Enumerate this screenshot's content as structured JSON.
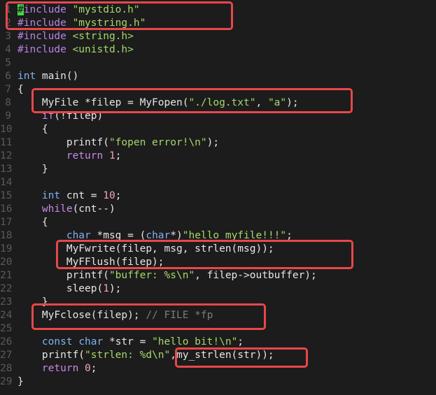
{
  "editor": {
    "lines": [
      {
        "n": "1",
        "tokens": [
          {
            "t": "#",
            "c": "cursor"
          },
          {
            "t": "include ",
            "c": "pp"
          },
          {
            "t": "\"mystdio.h\"",
            "c": "str"
          }
        ]
      },
      {
        "n": "2",
        "tokens": [
          {
            "t": "#include ",
            "c": "pp"
          },
          {
            "t": "\"mystring.h\"",
            "c": "str"
          }
        ]
      },
      {
        "n": "3",
        "tokens": [
          {
            "t": "#include ",
            "c": "pp"
          },
          {
            "t": "<string.h>",
            "c": "str"
          }
        ]
      },
      {
        "n": "4",
        "tokens": [
          {
            "t": "#include ",
            "c": "pp"
          },
          {
            "t": "<unistd.h>",
            "c": "str"
          }
        ]
      },
      {
        "n": "5",
        "tokens": []
      },
      {
        "n": "6",
        "tokens": [
          {
            "t": "int",
            "c": "type"
          },
          {
            "t": " main()",
            "c": ""
          }
        ]
      },
      {
        "n": "7",
        "tokens": [
          {
            "t": "{",
            "c": ""
          }
        ]
      },
      {
        "n": "8",
        "tokens": [
          {
            "t": "    MyFile *filep = MyFopen(",
            "c": ""
          },
          {
            "t": "\"./log.txt\"",
            "c": "str"
          },
          {
            "t": ", ",
            "c": ""
          },
          {
            "t": "\"a\"",
            "c": "str"
          },
          {
            "t": ");",
            "c": ""
          }
        ]
      },
      {
        "n": "9",
        "tokens": [
          {
            "t": "    ",
            "c": ""
          },
          {
            "t": "if",
            "c": "kw"
          },
          {
            "t": "(!filep)",
            "c": ""
          }
        ]
      },
      {
        "n": "10",
        "tokens": [
          {
            "t": "    {",
            "c": ""
          }
        ]
      },
      {
        "n": "11",
        "tokens": [
          {
            "t": "        printf(",
            "c": ""
          },
          {
            "t": "\"fopen error!\\n\"",
            "c": "str"
          },
          {
            "t": ");",
            "c": ""
          }
        ]
      },
      {
        "n": "12",
        "tokens": [
          {
            "t": "        ",
            "c": ""
          },
          {
            "t": "return",
            "c": "kw"
          },
          {
            "t": " ",
            "c": ""
          },
          {
            "t": "1",
            "c": "num"
          },
          {
            "t": ";",
            "c": ""
          }
        ]
      },
      {
        "n": "13",
        "tokens": [
          {
            "t": "    }",
            "c": ""
          }
        ]
      },
      {
        "n": "14",
        "tokens": []
      },
      {
        "n": "15",
        "tokens": [
          {
            "t": "    ",
            "c": ""
          },
          {
            "t": "int",
            "c": "type"
          },
          {
            "t": " cnt = ",
            "c": ""
          },
          {
            "t": "10",
            "c": "num"
          },
          {
            "t": ";",
            "c": ""
          }
        ]
      },
      {
        "n": "16",
        "tokens": [
          {
            "t": "    ",
            "c": ""
          },
          {
            "t": "while",
            "c": "kw"
          },
          {
            "t": "(cnt--)",
            "c": ""
          }
        ]
      },
      {
        "n": "17",
        "tokens": [
          {
            "t": "    {",
            "c": ""
          }
        ]
      },
      {
        "n": "18",
        "tokens": [
          {
            "t": "        ",
            "c": ""
          },
          {
            "t": "char",
            "c": "type"
          },
          {
            "t": " *msg = (",
            "c": ""
          },
          {
            "t": "char",
            "c": "type"
          },
          {
            "t": "*)",
            "c": ""
          },
          {
            "t": "\"hello myfile!!!\"",
            "c": "str"
          },
          {
            "t": ";",
            "c": ""
          }
        ]
      },
      {
        "n": "19",
        "tokens": [
          {
            "t": "        MyFwrite(filep, msg, strlen(msg));",
            "c": ""
          }
        ]
      },
      {
        "n": "20",
        "tokens": [
          {
            "t": "        MyFFlush(filep);",
            "c": ""
          }
        ]
      },
      {
        "n": "21",
        "tokens": [
          {
            "t": "        printf(",
            "c": ""
          },
          {
            "t": "\"buffer: %s\\n\"",
            "c": "str"
          },
          {
            "t": ", filep->outbuffer);",
            "c": ""
          }
        ]
      },
      {
        "n": "22",
        "tokens": [
          {
            "t": "        sleep(",
            "c": ""
          },
          {
            "t": "1",
            "c": "num"
          },
          {
            "t": ");",
            "c": ""
          }
        ]
      },
      {
        "n": "23",
        "tokens": [
          {
            "t": "    }",
            "c": ""
          }
        ]
      },
      {
        "n": "24",
        "tokens": [
          {
            "t": "    MyFclose(filep); ",
            "c": ""
          },
          {
            "t": "// FILE *fp",
            "c": "cmt"
          }
        ]
      },
      {
        "n": "25",
        "tokens": []
      },
      {
        "n": "26",
        "tokens": [
          {
            "t": "    ",
            "c": ""
          },
          {
            "t": "const",
            "c": "type"
          },
          {
            "t": " ",
            "c": ""
          },
          {
            "t": "char",
            "c": "type"
          },
          {
            "t": " *str = ",
            "c": ""
          },
          {
            "t": "\"hello bit!\\n\"",
            "c": "str"
          },
          {
            "t": ";",
            "c": ""
          }
        ]
      },
      {
        "n": "27",
        "tokens": [
          {
            "t": "    printf(",
            "c": ""
          },
          {
            "t": "\"strlen: %d\\n\"",
            "c": "str"
          },
          {
            "t": ",my_strlen(str));",
            "c": ""
          }
        ]
      },
      {
        "n": "28",
        "tokens": [
          {
            "t": "    ",
            "c": ""
          },
          {
            "t": "return",
            "c": "kw"
          },
          {
            "t": " ",
            "c": ""
          },
          {
            "t": "0",
            "c": "num"
          },
          {
            "t": ";",
            "c": ""
          }
        ]
      },
      {
        "n": "29",
        "tokens": [
          {
            "t": "}",
            "c": ""
          }
        ]
      }
    ]
  },
  "colors": {
    "background": "#1c1c1c",
    "highlight_box": "#e8474a",
    "cursor": "#49d64a"
  }
}
